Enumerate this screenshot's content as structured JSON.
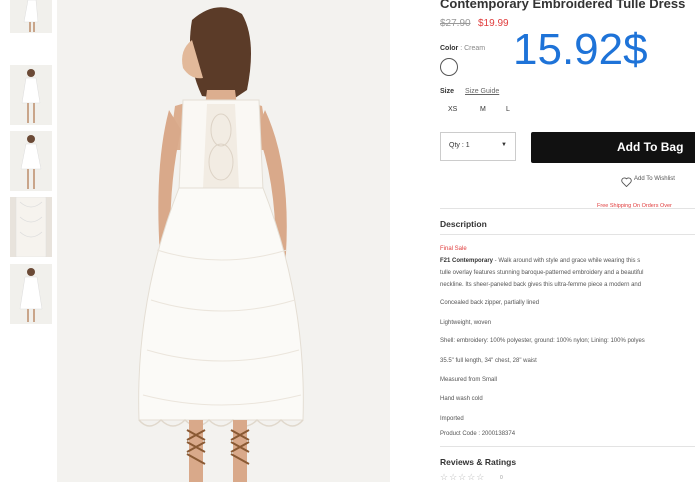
{
  "product": {
    "title": "Contemporary Embroidered Tulle Dress",
    "old_price": "$27.90",
    "sale_price": "$19.99",
    "overlay_price": "15.92$"
  },
  "color": {
    "label": "Color",
    "value": ": Cream",
    "swatch_hex": "#ffffff"
  },
  "size": {
    "label": "Size",
    "guide": "Size Guide",
    "options": [
      "XS",
      "M",
      "L"
    ]
  },
  "cart": {
    "qty_label": "Qty : 1",
    "add_label": "Add To Bag",
    "wishlist": "Add To Wishlist",
    "shipping": "Free Shipping On Orders Over"
  },
  "description": {
    "heading": "Description",
    "final_sale": "Final Sale",
    "brand": "F21 Contemporary",
    "intro": " - Walk around with style and grace while wearing this s",
    "line2": "tulle overlay features stunning baroque-patterned embroidery and a beautiful",
    "line3": "neckline. Its sheer-paneled back gives this ultra-femme piece a modern and",
    "bullets": [
      "Concealed back zipper, partially lined",
      "Lightweight, woven",
      "Shell: embroidery: 100% polyester, ground: 100% nylon; Lining: 100% polyes",
      "35.5\" full length, 34\" chest, 28\" waist",
      "Measured from Small",
      "Hand wash cold",
      "Imported"
    ],
    "product_code": "Product Code : 2000138374"
  },
  "reviews": {
    "heading": "Reviews & Ratings",
    "stars": "☆☆☆☆☆",
    "count": "0"
  },
  "images": {
    "thumbnail_count": 5,
    "main_alt": "model wearing cream lace dress, back view"
  }
}
